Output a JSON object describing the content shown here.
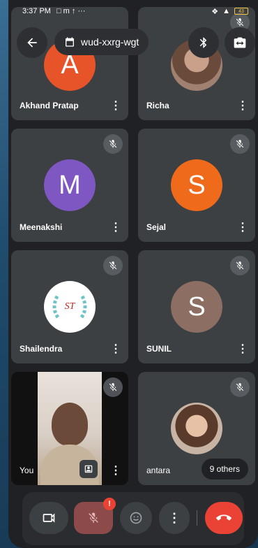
{
  "status": {
    "time": "3:37 PM",
    "battery": "43"
  },
  "header": {
    "meeting_code": "wud-xxrg-wgt"
  },
  "tiles": [
    {
      "name": "Akhand Pratap",
      "initial": "A",
      "color": "#e8542a"
    },
    {
      "name": "Richa"
    },
    {
      "name": "Meenakshi",
      "initial": "M",
      "color": "#7e57c2"
    },
    {
      "name": "Sejal",
      "initial": "S",
      "color": "#f06a1c"
    },
    {
      "name": "Shailendra",
      "logo_text": "ST"
    },
    {
      "name": "SUNIL",
      "initial": "S",
      "color": "#8d6e63"
    },
    {
      "name": "You"
    },
    {
      "name": "antara",
      "others": "9 others"
    }
  ],
  "controls": {
    "alert_badge": "!"
  }
}
